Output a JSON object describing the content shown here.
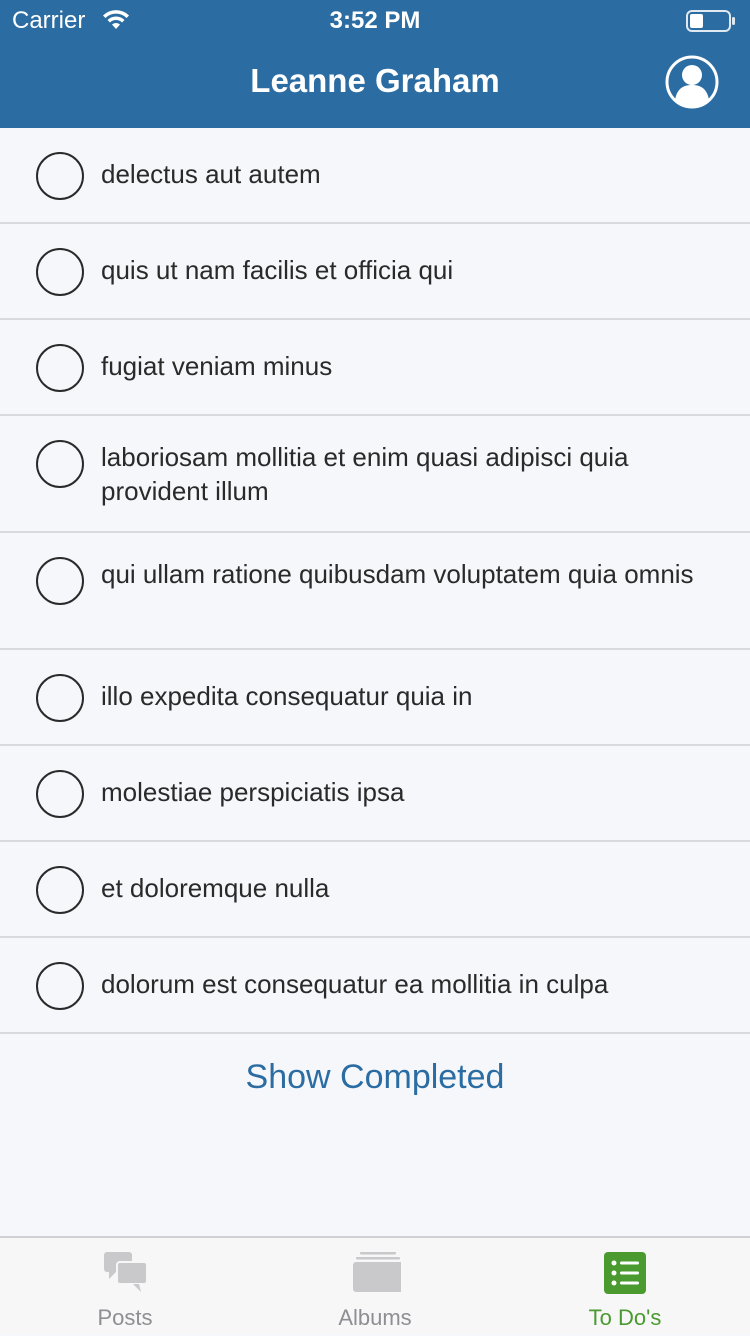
{
  "status_bar": {
    "carrier": "Carrier",
    "time": "3:52 PM"
  },
  "header": {
    "title": "Leanne Graham",
    "background_color": "#2b6ca2",
    "profile_icon": "user-circle-icon"
  },
  "todos": [
    {
      "title": "delectus aut autem",
      "completed": false
    },
    {
      "title": "quis ut nam facilis et officia qui",
      "completed": false
    },
    {
      "title": "fugiat veniam minus",
      "completed": false
    },
    {
      "title": "laboriosam mollitia et enim quasi adipisci quia provident illum",
      "completed": false
    },
    {
      "title": "qui ullam ratione quibusdam voluptatem quia omnis",
      "completed": false
    },
    {
      "title": "illo expedita consequatur quia in",
      "completed": false
    },
    {
      "title": "molestiae perspiciatis ipsa",
      "completed": false
    },
    {
      "title": "et doloremque nulla",
      "completed": false
    },
    {
      "title": "dolorum est consequatur ea mollitia in culpa",
      "completed": false
    }
  ],
  "show_completed_label": "Show Completed",
  "tabs": [
    {
      "label": "Posts",
      "icon": "chat-bubbles-icon",
      "active": false
    },
    {
      "label": "Albums",
      "icon": "album-stack-icon",
      "active": false
    },
    {
      "label": "To Do's",
      "icon": "checklist-icon",
      "active": true
    }
  ],
  "colors": {
    "accent": "#2b6ca2",
    "active_tab": "#4a9a30",
    "inactive_tab": "#8e8e93"
  }
}
